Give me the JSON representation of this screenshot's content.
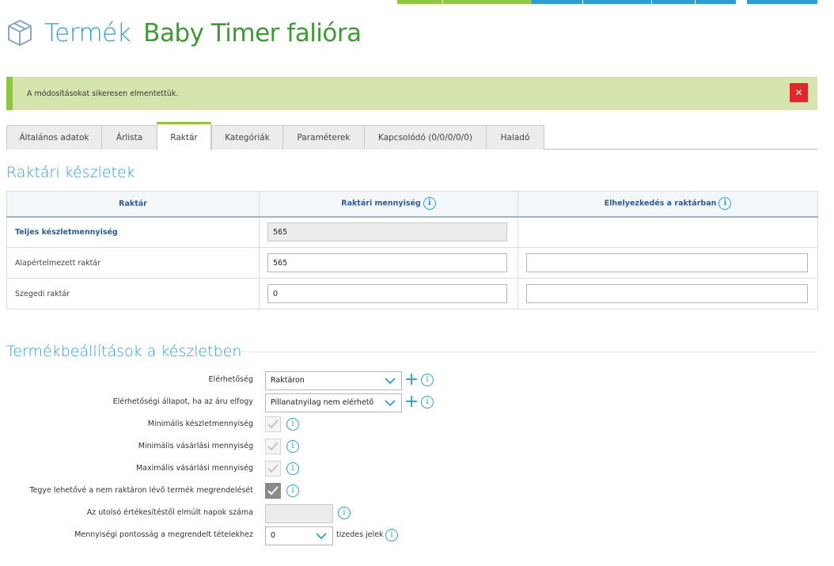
{
  "header": {
    "title_prefix": "Termék",
    "product_name": "Baby Timer falióra"
  },
  "alert": {
    "message": "A módosításokat sikeresen elmentettük.",
    "close_symbol": "✕"
  },
  "tabs": [
    {
      "label": "Általános adatok"
    },
    {
      "label": "Árlista"
    },
    {
      "label": "Raktár"
    },
    {
      "label": "Kategóriák"
    },
    {
      "label": "Paraméterek"
    },
    {
      "label": "Kapcsolódó (0/0/0/0/0)"
    },
    {
      "label": "Haladó"
    }
  ],
  "active_tab": "Raktár",
  "stock": {
    "title": "Raktári készletek",
    "columns": [
      "Raktár",
      "Raktári mennyiség",
      "Elhelyezkedés a raktárban"
    ],
    "rows": [
      {
        "name": "Teljes készletmennyiség",
        "quantity": "565",
        "location": ""
      },
      {
        "name": "Alapértelmezett raktár",
        "quantity": "565",
        "location": ""
      },
      {
        "name": "Szegedi raktár",
        "quantity": "0",
        "location": ""
      }
    ]
  },
  "settings": {
    "title": "Termékbeállítások a készletben",
    "availability_label": "Elérhetőség",
    "availability_value": "Raktáron",
    "out_of_stock_label": "Elérhetőségi állapot, ha az áru elfogy",
    "out_of_stock_value": "Pillanatnyilag nem elérhető",
    "min_stock_label": "Minimális készletmennyiség",
    "min_purchase_label": "Minimális vásárlási mennyiség",
    "max_purchase_label": "Maximális vásárlási mennyiség",
    "allow_backorder_label": "Tegye lehetővé a nem raktáron lévő termék megrendelését",
    "days_since_sale_label": "Az utolsó értékesítéstől elmúlt napok száma",
    "days_since_sale_value": "",
    "precision_label": "Mennyiségi pontosság a megrendelt tételekhez",
    "precision_value": "0",
    "precision_suffix": "tizedes jelek"
  },
  "colors": {
    "accent_blue": "#2a9fd6",
    "accent_green": "#8dc63f",
    "alert_bg": "#d6e4ae",
    "close_red": "#e2272c"
  }
}
